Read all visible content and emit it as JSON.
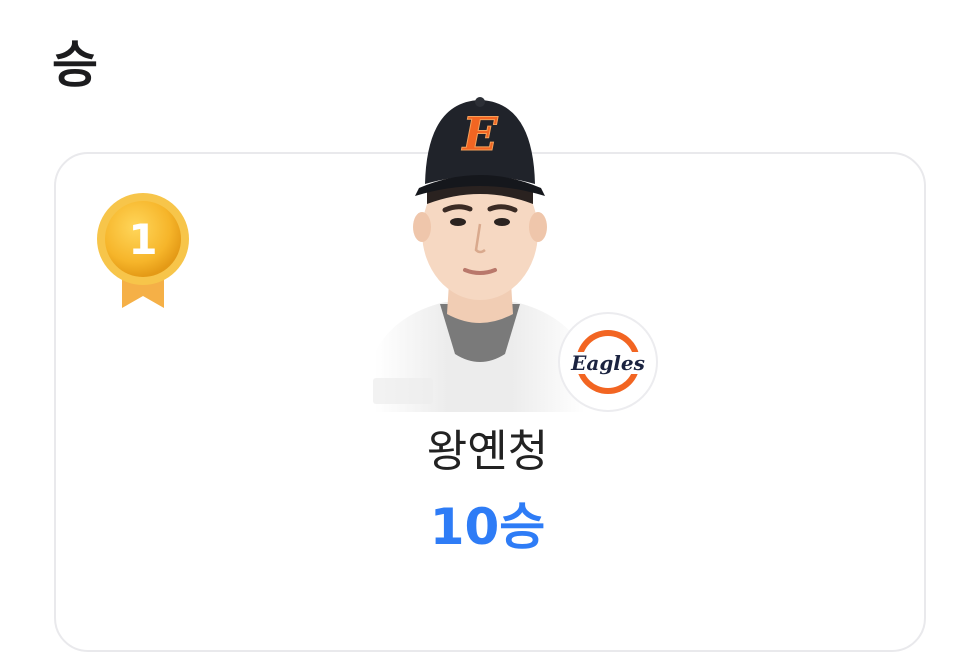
{
  "section": {
    "title": "승"
  },
  "ranking": {
    "rank": "1",
    "player_name": "왕옌청",
    "stat_value": "10승",
    "team_logo_text": "Eagles",
    "cap_letter": "E"
  },
  "colors": {
    "accent": "#2e7cf6",
    "medal_gold": "#f5b82e",
    "team_orange": "#f26522"
  },
  "icons": [
    "gold-medal-icon",
    "team-logo-icon"
  ]
}
